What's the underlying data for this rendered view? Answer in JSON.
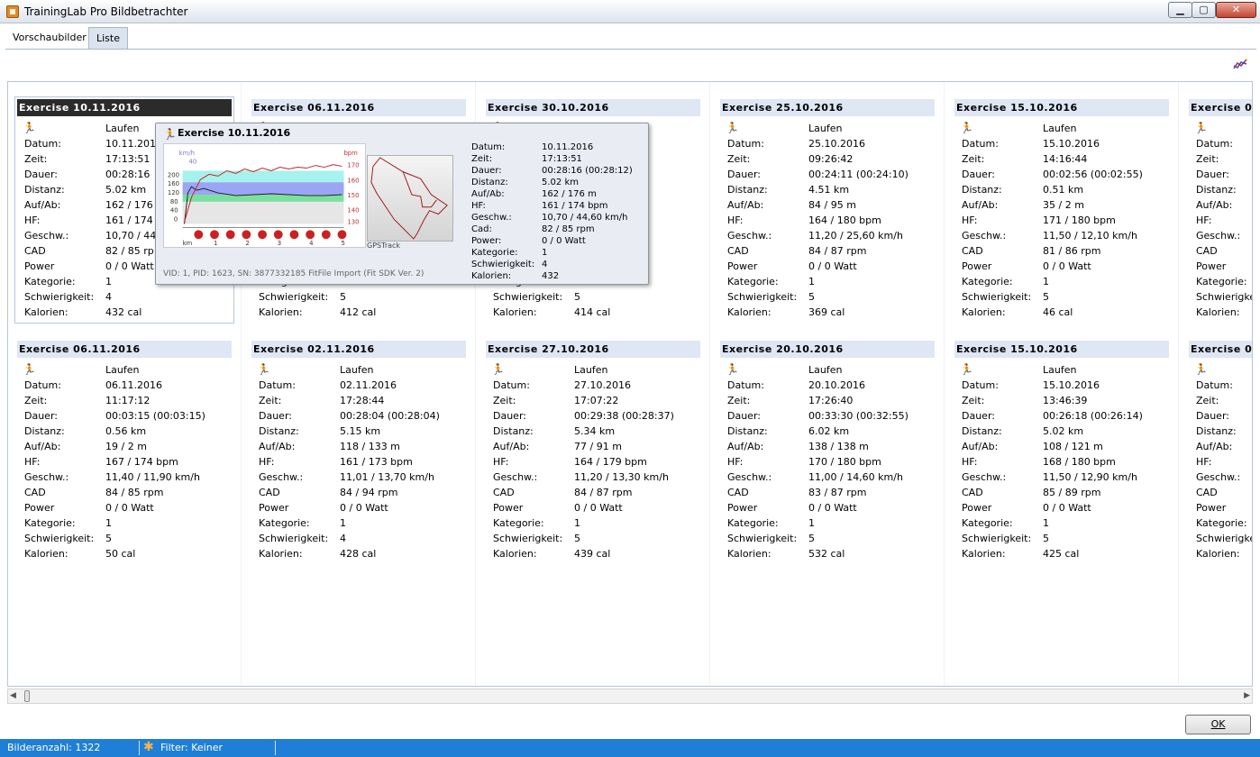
{
  "window": {
    "title": "TrainingLab Pro Bildbetrachter",
    "min_label": "▁",
    "max_label": "▢",
    "close_label": "✕"
  },
  "tabs": [
    {
      "label": "Vorschaubilder"
    },
    {
      "label": "Liste"
    }
  ],
  "field_labels": [
    "Datum:",
    "Zeit:",
    "Dauer:",
    "Distanz:",
    "Auf/Ab:",
    "HF:",
    "Geschw.:",
    "CAD",
    "Power",
    "Kategorie:",
    "Schwierigkeit:",
    "Kalorien:"
  ],
  "cards": [
    {
      "title": "Exercise 10.11.2016",
      "sport": "Laufen",
      "values": [
        "10.11.2016",
        "17:13:51",
        "00:28:16",
        "5.02 km",
        "162 / 176",
        "161 / 174",
        "10,70 / 44",
        "82 / 85 rp",
        "0 / 0 Watt",
        "1",
        "4",
        "432 cal"
      ]
    },
    {
      "title": "Exercise 06.11.2016",
      "sport": "",
      "values": [
        "",
        "",
        "",
        "",
        "",
        "",
        "",
        "",
        "",
        "1",
        "5",
        "412 cal"
      ]
    },
    {
      "title": "Exercise 30.10.2016",
      "sport": "",
      "values": [
        "",
        "",
        "25:57)",
        "",
        "",
        "",
        "km/h",
        "",
        "",
        "1",
        "5",
        "414 cal"
      ]
    },
    {
      "title": "Exercise 25.10.2016",
      "sport": "Laufen",
      "values": [
        "25.10.2016",
        "09:26:42",
        "00:24:11 (00:24:10)",
        "4.51 km",
        "84 / 95 m",
        "164 / 180 bpm",
        "11,20 / 25,60 km/h",
        "84 / 87 rpm",
        "0 / 0 Watt",
        "1",
        "5",
        "369 cal"
      ]
    },
    {
      "title": "Exercise 15.10.2016",
      "sport": "Laufen",
      "values": [
        "15.10.2016",
        "14:16:44",
        "00:02:56 (00:02:55)",
        "0.51 km",
        "35 / 2 m",
        "171 / 180 bpm",
        "11,50 / 12,10 km/h",
        "81 / 86 rpm",
        "0 / 0 Watt",
        "1",
        "5",
        "46 cal"
      ]
    },
    {
      "title": "Exercise 0",
      "sport": "",
      "values": [
        "",
        "",
        "",
        "",
        "",
        "",
        "",
        "",
        "",
        "",
        "",
        ""
      ]
    },
    {
      "title": "Exercise 06.11.2016",
      "sport": "Laufen",
      "values": [
        "06.11.2016",
        "11:17:12",
        "00:03:15 (00:03:15)",
        "0.56 km",
        "19 / 2 m",
        "167 / 174 bpm",
        "11,40 / 11,90 km/h",
        "84 / 85 rpm",
        "0 / 0 Watt",
        "1",
        "5",
        "50 cal"
      ]
    },
    {
      "title": "Exercise 02.11.2016",
      "sport": "Laufen",
      "values": [
        "02.11.2016",
        "17:28:44",
        "00:28:04 (00:28:04)",
        "5.15 km",
        "118 / 133 m",
        "161 / 173 bpm",
        "11,01 / 13,70 km/h",
        "84 / 94 rpm",
        "0 / 0 Watt",
        "1",
        "4",
        "428 cal"
      ]
    },
    {
      "title": "Exercise 27.10.2016",
      "sport": "Laufen",
      "values": [
        "27.10.2016",
        "17:07:22",
        "00:29:38 (00:28:37)",
        "5.34 km",
        "77 / 91 m",
        "164 / 179 bpm",
        "11,20 / 13,30 km/h",
        "84 / 87 rpm",
        "0 / 0 Watt",
        "1",
        "5",
        "439 cal"
      ]
    },
    {
      "title": "Exercise 20.10.2016",
      "sport": "Laufen",
      "values": [
        "20.10.2016",
        "17:26:40",
        "00:33:30 (00:32:55)",
        "6.02 km",
        "138 / 138 m",
        "170 / 180 bpm",
        "11,00 / 14,60 km/h",
        "83 / 87 rpm",
        "0 / 0 Watt",
        "1",
        "5",
        "532 cal"
      ]
    },
    {
      "title": "Exercise 15.10.2016",
      "sport": "Laufen",
      "values": [
        "15.10.2016",
        "13:46:39",
        "00:26:18 (00:26:14)",
        "5.02 km",
        "108 / 121 m",
        "168 / 180 bpm",
        "11,50 / 12,90 km/h",
        "85 / 89 rpm",
        "0 / 0 Watt",
        "1",
        "5",
        "425 cal"
      ]
    },
    {
      "title": "Exercise 0",
      "sport": "",
      "values": [
        "",
        "",
        "",
        "",
        "",
        "",
        "",
        "",
        "",
        "",
        "",
        ""
      ]
    }
  ],
  "tooltip": {
    "title": "Exercise 10.11.2016",
    "chart": {
      "left_unit": "km/h",
      "right_unit": "bpm",
      "left_ticks": [
        "200",
        "160",
        "120",
        "80",
        "40",
        "0"
      ],
      "right_ticks": [
        "170",
        "160",
        "150",
        "140",
        "130"
      ],
      "x_unit": "km",
      "x_ticks": [
        "1",
        "2",
        "3",
        "4",
        "5"
      ],
      "right_marker": "40"
    },
    "gps_label": "GPSTrack",
    "labels": [
      "Datum:",
      "Zeit:",
      "Dauer:",
      "Distanz:",
      "Auf/Ab:",
      "HF:",
      "Geschw.:",
      "Cad:",
      "Power:",
      "Kategorie:",
      "Schwierigkeit:",
      "Kalorien:"
    ],
    "values": [
      "10.11.2016",
      "17:13:51",
      "00:28:16 (00:28:12)",
      "5.02 km",
      "162 / 176 m",
      "161 / 174 bpm",
      "10,70 / 44,60 km/h",
      "82 / 85 rpm",
      "0 / 0 Watt",
      "1",
      "4",
      "432"
    ],
    "footer": "VID: 1, PID: 1623, SN: 3877332185 FitFile Import (Fit SDK Ver. 2)"
  },
  "ok_label": "OK",
  "status": {
    "count": "Bilderanzahl: 1322",
    "filter": "Filter: Keiner"
  },
  "icons": {
    "app": "app-icon",
    "runner": "runner-icon",
    "chart": "chart-toggle-icon",
    "filter": "filter-icon"
  }
}
